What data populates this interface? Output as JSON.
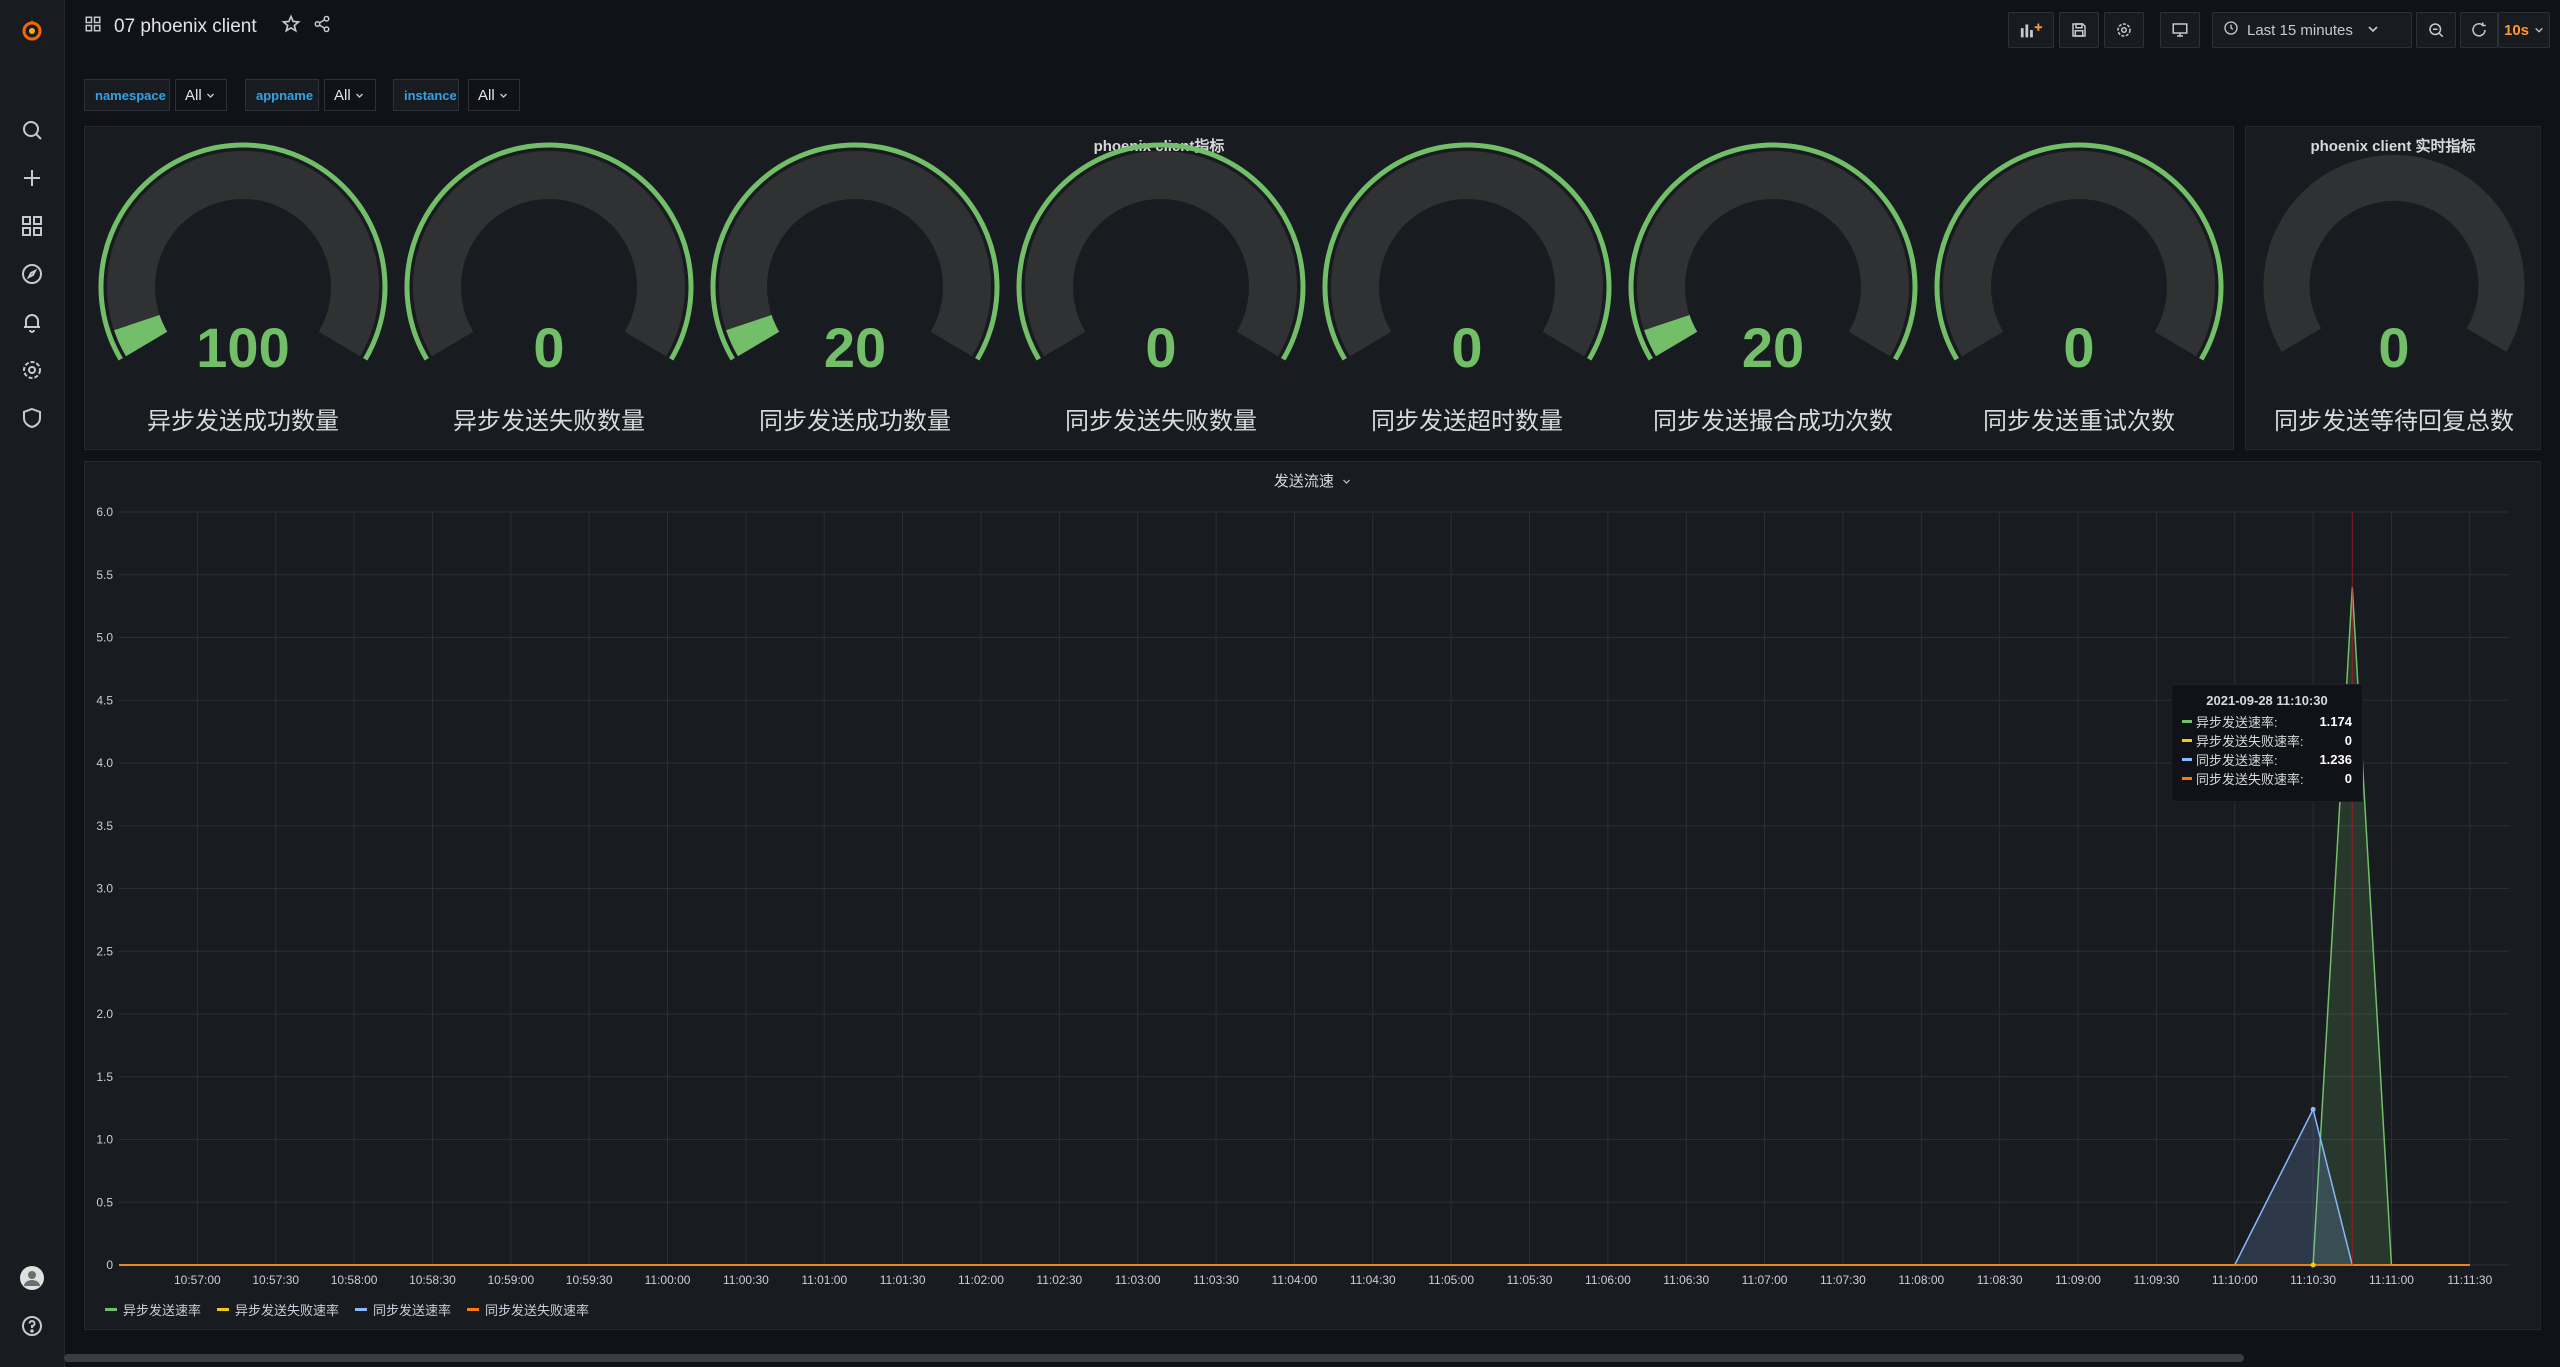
{
  "dashboard": {
    "title": "07 phoenix client",
    "time_range": "Last 15 minutes",
    "refresh": "10s"
  },
  "icons": {
    "logo": "grafana-logo",
    "sidebar": [
      "search-icon",
      "plus-icon",
      "dashboards-icon",
      "compass-icon",
      "bell-icon",
      "gear-icon",
      "shield-icon"
    ],
    "bottom": [
      "avatar",
      "help-icon"
    ]
  },
  "variables": [
    {
      "label": "namespace",
      "value": "All"
    },
    {
      "label": "appname",
      "value": "All"
    },
    {
      "label": "instance",
      "value": "All"
    }
  ],
  "panel_metrics": {
    "title": "phoenix client指标",
    "gauges": [
      {
        "label": "异步发送成功数量",
        "value": "100",
        "fraction": 0.05
      },
      {
        "label": "异步发送失败数量",
        "value": "0",
        "fraction": 0
      },
      {
        "label": "同步发送成功数量",
        "value": "20",
        "fraction": 0.05
      },
      {
        "label": "同步发送失败数量",
        "value": "0",
        "fraction": 0
      },
      {
        "label": "同步发送超时数量",
        "value": "0",
        "fraction": 0
      },
      {
        "label": "同步发送撮合成功次数",
        "value": "20",
        "fraction": 0.05
      },
      {
        "label": "同步发送重试次数",
        "value": "0",
        "fraction": 0
      }
    ]
  },
  "panel_realtime": {
    "title": "phoenix client 实时指标",
    "gauge": {
      "label": "同步发送等待回复总数",
      "value": "0",
      "fraction": 0
    }
  },
  "panel_flow": {
    "title": "发送流速",
    "tooltip": {
      "time": "2021-09-28 11:10:30",
      "rows": [
        {
          "name": "异步发送速率:",
          "value": "1.174",
          "color": "#73bf69"
        },
        {
          "name": "异步发送失败速率:",
          "value": "0",
          "color": "#f2cc0c"
        },
        {
          "name": "同步发送速率:",
          "value": "1.236",
          "color": "#8ab8ff"
        },
        {
          "name": "同步发送失败速率:",
          "value": "0",
          "color": "#ff780a"
        }
      ]
    },
    "legend": [
      {
        "name": "异步发送速率",
        "color": "#73bf69"
      },
      {
        "name": "异步发送失败速率",
        "color": "#f2cc0c"
      },
      {
        "name": "同步发送速率",
        "color": "#8ab8ff"
      },
      {
        "name": "同步发送失败速率",
        "color": "#ff780a"
      }
    ]
  },
  "chart_data": {
    "type": "area",
    "title": "发送流速",
    "x": [
      "10:57:00",
      "10:57:30",
      "10:58:00",
      "10:58:30",
      "10:59:00",
      "10:59:30",
      "11:00:00",
      "11:00:30",
      "11:01:00",
      "11:01:30",
      "11:02:00",
      "11:02:30",
      "11:03:00",
      "11:03:30",
      "11:04:00",
      "11:04:30",
      "11:05:00",
      "11:05:30",
      "11:06:00",
      "11:06:30",
      "11:07:00",
      "11:07:30",
      "11:08:00",
      "11:08:30",
      "11:09:00",
      "11:09:30",
      "11:10:00",
      "11:10:30",
      "11:11:00",
      "11:11:30"
    ],
    "yticks": [
      "0",
      "0.5",
      "1.0",
      "1.5",
      "2.0",
      "2.5",
      "3.0",
      "3.5",
      "4.0",
      "4.5",
      "5.0",
      "5.5",
      "6.0"
    ],
    "ylim": [
      0,
      6
    ],
    "series": [
      {
        "name": "异步发送速率",
        "color": "#73bf69",
        "points": [
          [
            "10:56:30",
            0
          ],
          [
            "11:10:30",
            0
          ],
          [
            "11:10:45",
            5.4
          ],
          [
            "11:11:00",
            0
          ],
          [
            "11:11:30",
            0
          ]
        ]
      },
      {
        "name": "异步发送失败速率",
        "color": "#f2cc0c",
        "points": [
          [
            "10:56:30",
            0
          ],
          [
            "11:11:30",
            0
          ]
        ]
      },
      {
        "name": "同步发送速率",
        "color": "#8ab8ff",
        "points": [
          [
            "10:56:30",
            0
          ],
          [
            "11:10:00",
            0
          ],
          [
            "11:10:30",
            1.24
          ],
          [
            "11:10:45",
            0
          ],
          [
            "11:11:30",
            0
          ]
        ]
      },
      {
        "name": "同步发送失败速率",
        "color": "#ff780a",
        "points": [
          [
            "10:56:30",
            0
          ],
          [
            "11:11:30",
            0
          ]
        ]
      }
    ],
    "crosshair_time": "11:10:45",
    "grid": true,
    "legend_position": "bottom-left"
  }
}
